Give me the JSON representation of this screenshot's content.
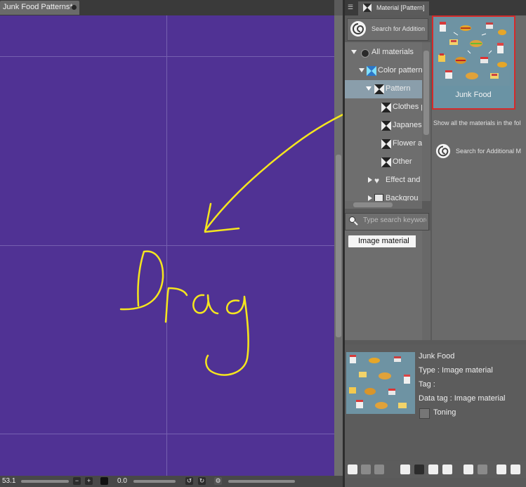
{
  "document": {
    "tab_title": "Junk Food Patterns*"
  },
  "canvas": {
    "background": "#503294",
    "annotation_color": "#f5e61e"
  },
  "statusbar": {
    "zoom": "53.1",
    "angle": "0.0"
  },
  "palette": {
    "tab_title": "Material [Pattern]",
    "search_additional_label": "Search for Additional",
    "tree": {
      "items": [
        {
          "label": "All materials",
          "icon": "materials-root-icon"
        },
        {
          "label": "Color pattern",
          "icon": "color-pattern-icon"
        },
        {
          "label": "Pattern",
          "icon": "pattern-icon"
        },
        {
          "label": "Clothes p",
          "icon": "pattern-icon"
        },
        {
          "label": "Japanes",
          "icon": "pattern-icon"
        },
        {
          "label": "Flower a",
          "icon": "pattern-icon"
        },
        {
          "label": "Other",
          "icon": "pattern-icon"
        },
        {
          "label": "Effect and",
          "icon": "heart-icon"
        },
        {
          "label": "Backgrou",
          "icon": "image-icon"
        }
      ]
    },
    "tag_search_placeholder": "Type search keywords",
    "tags": [
      "Image material"
    ],
    "materials": [
      {
        "label": "Junk Food",
        "selected": true
      }
    ],
    "show_all_text": "Show all the materials in the fol",
    "search_additional_label_2": "Search for Additional M",
    "details": {
      "name": "Junk Food",
      "type": "Type : Image material",
      "tag": "Tag :",
      "data_tag": "Data tag : Image material",
      "toning_label": "Toning",
      "toning_checked": false
    }
  }
}
